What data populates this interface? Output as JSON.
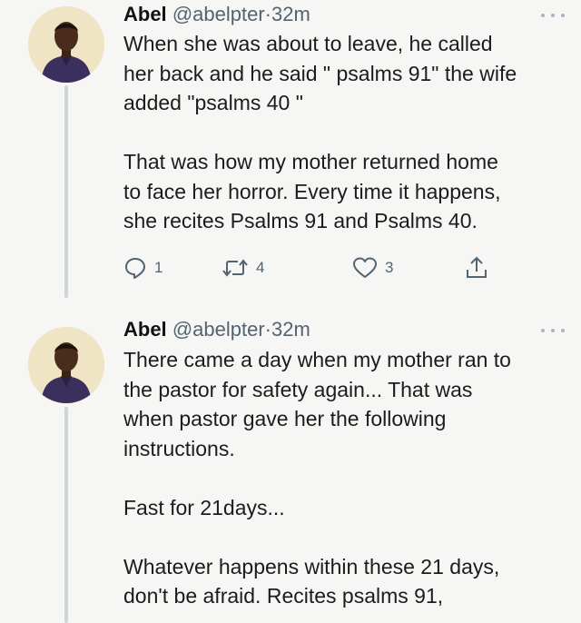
{
  "tweets": [
    {
      "author_name": "Abel",
      "handle": "@abelpter",
      "separator": "·",
      "time": "32m",
      "lines": [
        "When she was about to leave, he called",
        "her back and he said \" psalms 91\" the wife",
        "added \"psalms 40 \"",
        "",
        "That was how my mother returned home",
        "to face her horror.  Every time it happens,",
        "she recites Psalms 91 and Psalms 40."
      ],
      "actions": {
        "reply_count": "1",
        "retweet_count": "4",
        "like_count": "3"
      }
    },
    {
      "author_name": "Abel",
      "handle": "@abelpter",
      "separator": "·",
      "time": "32m",
      "lines": [
        "There came a day when my mother ran to",
        "the pastor for safety again... That was",
        "when pastor gave her the following",
        "instructions.",
        "",
        "Fast for 21days...",
        "",
        "Whatever happens within these 21 days,",
        "don't be afraid. Recites psalms 91,"
      ]
    }
  ],
  "icons": {
    "reply": "speech-bubble-icon",
    "retweet": "retweet-arrows-icon",
    "like": "heart-outline-icon",
    "share": "share-upload-icon",
    "more": "more-dots-icon"
  },
  "colors": {
    "background": "#f6f6f4",
    "secondary_text": "#536471",
    "thread_line": "#cfd6db"
  }
}
